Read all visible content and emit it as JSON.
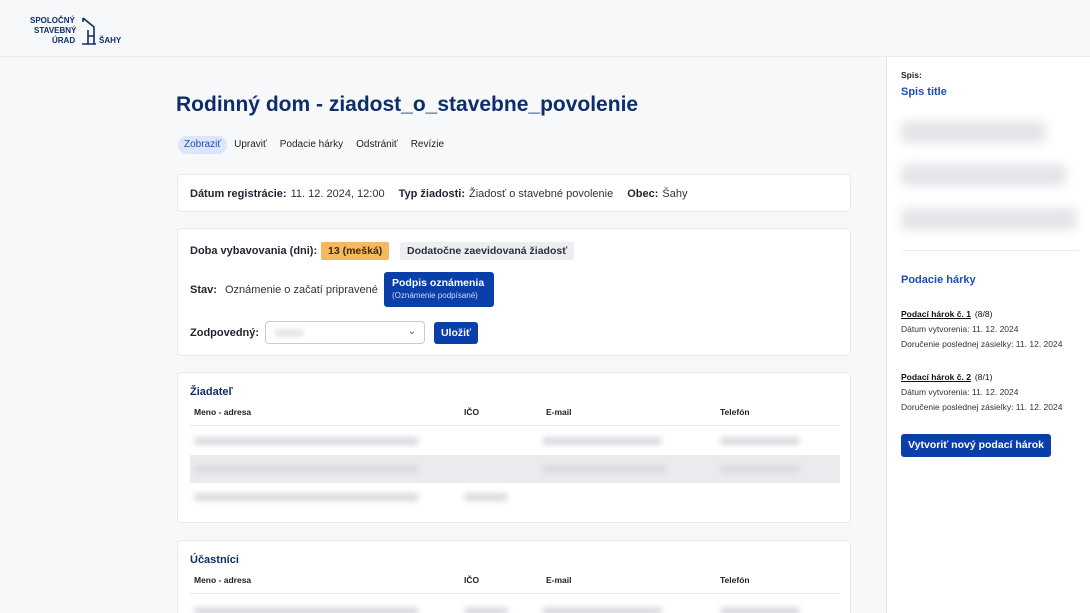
{
  "logo": {
    "line1": "SPOLOČNÝ",
    "line2": "STAVEBNÝ",
    "line3": "ÚRAD",
    "line4": "ŠAHY"
  },
  "page_title": "Rodinný dom - ziadost_o_stavebne_povolenie",
  "tabs": [
    {
      "label": "Zobraziť",
      "active": true
    },
    {
      "label": "Upraviť",
      "active": false
    },
    {
      "label": "Podacie hárky",
      "active": false
    },
    {
      "label": "Odstrániť",
      "active": false
    },
    {
      "label": "Revízie",
      "active": false
    }
  ],
  "info": {
    "registration_label": "Dátum registrácie:",
    "registration_value": "11. 12. 2024, 12:00",
    "type_label": "Typ žiadosti:",
    "type_value": "Žiadosť o stavebné povolenie",
    "city_label": "Obec:",
    "city_value": "Šahy"
  },
  "status": {
    "duration_label": "Doba vybavovania (dni):",
    "duration_badge": "13 (mešká)",
    "extra_badge": "Dodatočne zaevidovaná žiadosť",
    "state_label": "Stav:",
    "state_value": "Oznámenie o začatí pripravené",
    "sign_button": "Podpis oznámenia",
    "sign_button_sub": "(Oznámenie podpísané)",
    "responsible_label": "Zodpovedný:",
    "save_button": "Uložiť"
  },
  "applicant": {
    "title": "Žiadateľ",
    "columns": [
      "Meno - adresa",
      "IČO",
      "E-mail",
      "Telefón"
    ]
  },
  "participants": {
    "title": "Účastníci",
    "columns": [
      "Meno - adresa",
      "IČO",
      "E-mail",
      "Telefón"
    ]
  },
  "sidebar": {
    "file_label": "Spis:",
    "file_title": "Spis title",
    "sheets_title": "Podacie hárky",
    "sheets": [
      {
        "name": "Podací hárok č. 1",
        "count": "(8/8)",
        "created": "Dátum vytvorenia: 11. 12. 2024",
        "delivery": "Doručenie poslednej zásielky: 11. 12. 2024"
      },
      {
        "name": "Podací hárok č. 2",
        "count": "(8/1)",
        "created": "Dátum vytvorenia: 11. 12. 2024",
        "delivery": "Doručenie poslednej zásielky: 11. 12. 2024"
      }
    ],
    "new_sheet_button": "Vytvoriť nový podací hárok"
  },
  "colors": {
    "brand": "#0f2d69",
    "primary_button": "#0a3ea8",
    "warning_badge": "#f4b860"
  }
}
